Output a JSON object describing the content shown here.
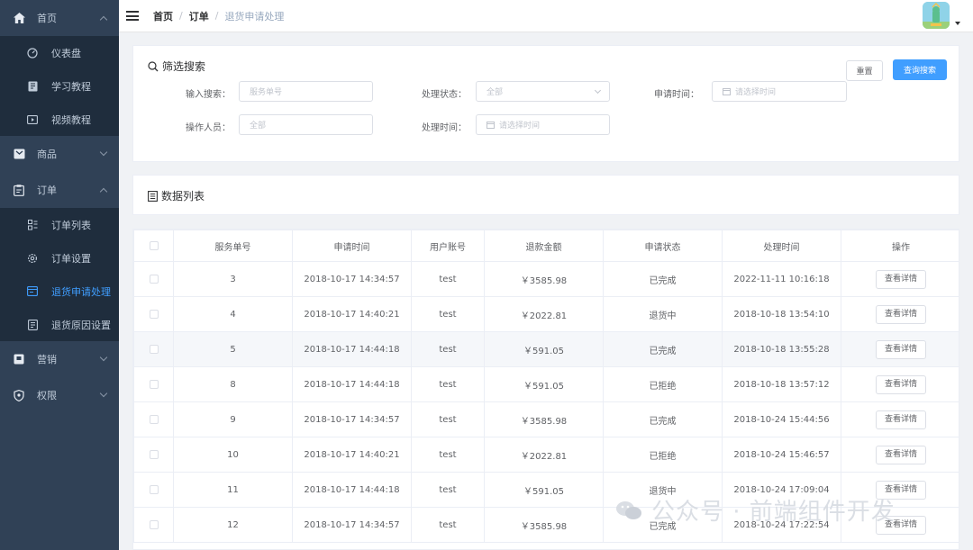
{
  "sidebar": {
    "groups": [
      {
        "label": "首页",
        "icon": "home-icon",
        "expanded": true,
        "items": [
          {
            "label": "仪表盘",
            "icon": "dashboard-icon"
          },
          {
            "label": "学习教程",
            "icon": "book-icon"
          },
          {
            "label": "视频教程",
            "icon": "video-icon"
          }
        ]
      },
      {
        "label": "商品",
        "icon": "goods-icon",
        "expanded": false
      },
      {
        "label": "订单",
        "icon": "order-icon",
        "expanded": true,
        "items": [
          {
            "label": "订单列表",
            "icon": "list-icon"
          },
          {
            "label": "订单设置",
            "icon": "gear-icon"
          },
          {
            "label": "退货申请处理",
            "icon": "return-icon",
            "active": true
          },
          {
            "label": "退货原因设置",
            "icon": "reason-icon"
          }
        ]
      },
      {
        "label": "营销",
        "icon": "marketing-icon",
        "expanded": false
      },
      {
        "label": "权限",
        "icon": "shield-icon",
        "expanded": false
      }
    ]
  },
  "navbar": {
    "breadcrumb": [
      "首页",
      "订单",
      "退货申请处理"
    ],
    "avatar_icon": "avatar-icon"
  },
  "filter": {
    "title": "筛选搜索",
    "reset_label": "重置",
    "search_label": "查询搜索",
    "fields": {
      "keyword": {
        "label": "输入搜索：",
        "placeholder": "服务单号"
      },
      "status": {
        "label": "处理状态：",
        "placeholder": "全部"
      },
      "apply_time": {
        "label": "申请时间：",
        "placeholder": "请选择时间"
      },
      "operator": {
        "label": "操作人员：",
        "placeholder": "全部"
      },
      "handle_time": {
        "label": "处理时间：",
        "placeholder": "请选择时间"
      }
    }
  },
  "list": {
    "title": "数据列表",
    "columns": [
      "服务单号",
      "申请时间",
      "用户账号",
      "退款金额",
      "申请状态",
      "处理时间",
      "操作"
    ],
    "action_label": "查看详情",
    "rows": [
      {
        "id": "3",
        "apply": "2018-10-17 14:34:57",
        "user": "test",
        "amount": "￥3585.98",
        "status": "已完成",
        "handled": "2022-11-11 10:16:18"
      },
      {
        "id": "4",
        "apply": "2018-10-17 14:40:21",
        "user": "test",
        "amount": "￥2022.81",
        "status": "退货中",
        "handled": "2018-10-18 13:54:10"
      },
      {
        "id": "5",
        "apply": "2018-10-17 14:44:18",
        "user": "test",
        "amount": "￥591.05",
        "status": "已完成",
        "handled": "2018-10-18 13:55:28"
      },
      {
        "id": "8",
        "apply": "2018-10-17 14:44:18",
        "user": "test",
        "amount": "￥591.05",
        "status": "已拒绝",
        "handled": "2018-10-18 13:57:12"
      },
      {
        "id": "9",
        "apply": "2018-10-17 14:34:57",
        "user": "test",
        "amount": "￥3585.98",
        "status": "已完成",
        "handled": "2018-10-24 15:44:56"
      },
      {
        "id": "10",
        "apply": "2018-10-17 14:40:21",
        "user": "test",
        "amount": "￥2022.81",
        "status": "已拒绝",
        "handled": "2018-10-24 15:46:57"
      },
      {
        "id": "11",
        "apply": "2018-10-17 14:44:18",
        "user": "test",
        "amount": "￥591.05",
        "status": "退货中",
        "handled": "2018-10-24 17:09:04"
      },
      {
        "id": "12",
        "apply": "2018-10-17 14:34:57",
        "user": "test",
        "amount": "￥3585.98",
        "status": "已完成",
        "handled": "2018-10-24 17:22:54"
      }
    ],
    "highlight_row_index": 2
  },
  "watermark": {
    "text": "公众号 · 前端组件开发"
  },
  "colors": {
    "sidebar_bg": "#304156",
    "submenu_bg": "#1f2d3d",
    "accent": "#409eff",
    "page_bg": "#f0f2f5"
  }
}
